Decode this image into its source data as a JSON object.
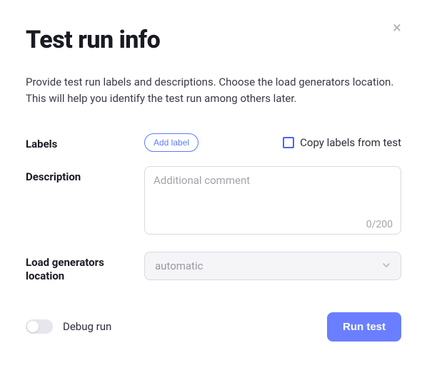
{
  "title": "Test run info",
  "intro": "Provide test run labels and descriptions. Choose the load generators location. This will help you identify the test run among others later.",
  "labels": {
    "section_label": "Labels",
    "add_label_btn": "Add label",
    "copy_checkbox_label": "Copy labels from test",
    "copy_checked": false
  },
  "description": {
    "section_label": "Description",
    "placeholder": "Additional comment",
    "value": "",
    "char_count": "0/200"
  },
  "load_generators": {
    "section_label": "Load generators location",
    "selected": "automatic"
  },
  "footer": {
    "debug_label": "Debug run",
    "debug_on": false,
    "run_btn": "Run test"
  }
}
